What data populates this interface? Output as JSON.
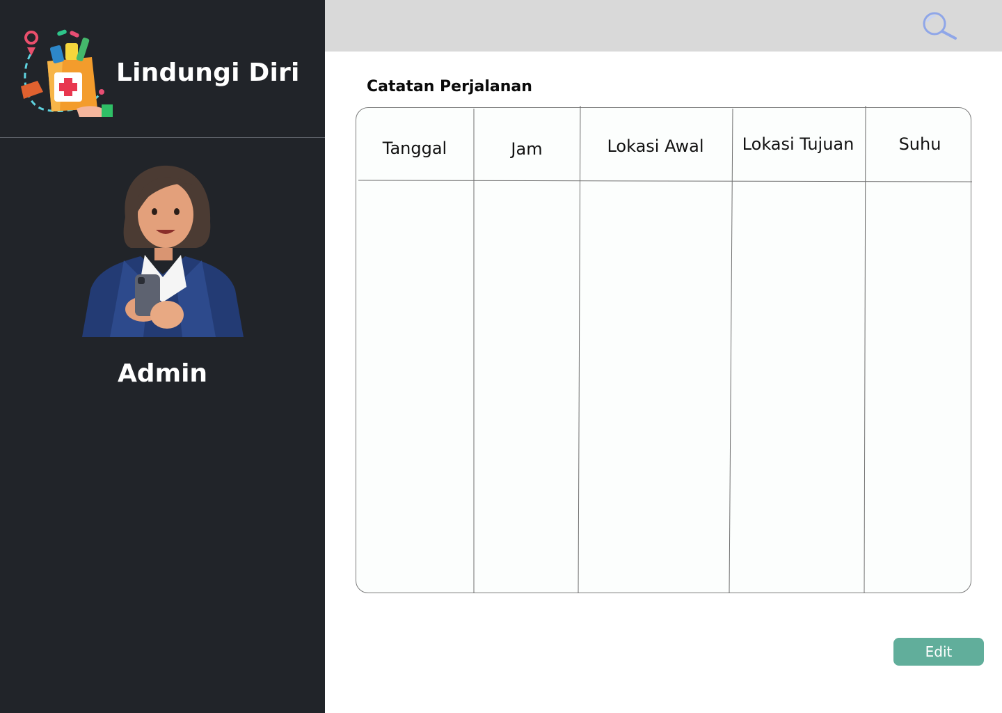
{
  "app": {
    "title": "Lindungi Diri"
  },
  "user": {
    "name": "Admin"
  },
  "header": {
    "search_icon": "search-icon"
  },
  "main": {
    "section_title": "Catatan Perjalanan",
    "table": {
      "columns": [
        "Tanggal",
        "Jam",
        "Lokasi Awal",
        "Lokasi Tujuan",
        "Suhu"
      ],
      "rows": []
    },
    "edit_label": "Edit"
  },
  "colors": {
    "sidebar_bg": "#212429",
    "topbar_bg": "#d9d9d9",
    "accent_button": "#61ae9b",
    "search_icon": "#8fa6e8"
  }
}
